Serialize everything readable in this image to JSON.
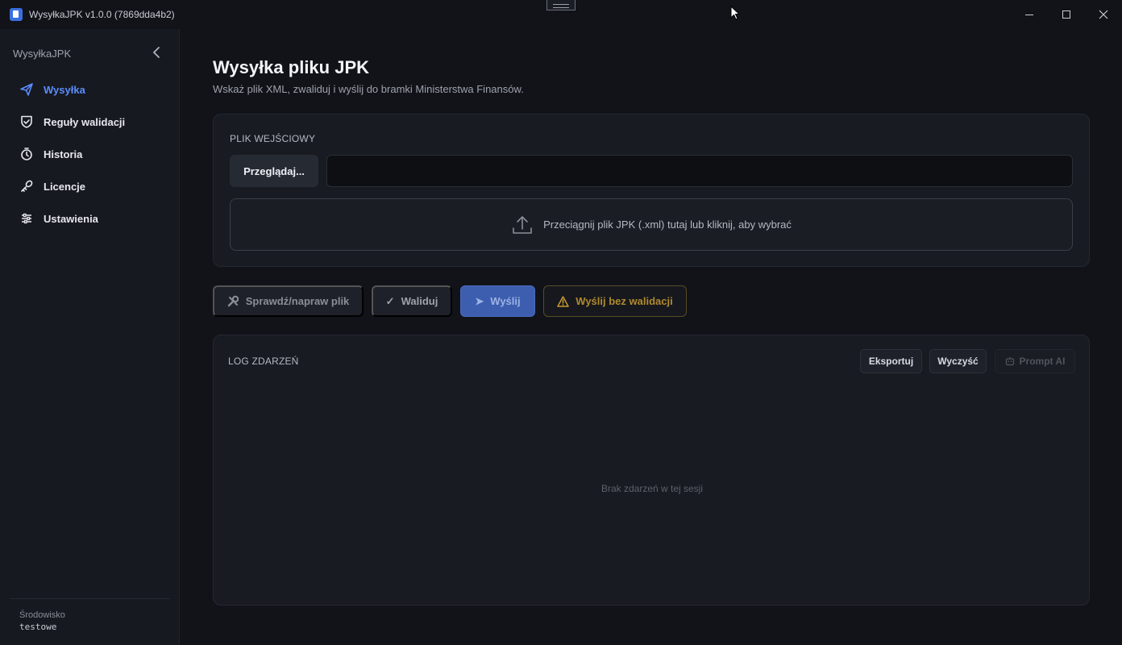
{
  "window": {
    "title": "WysyłkaJPK  v1.0.0 (7869dda4b2)",
    "controls": [
      "minimize",
      "maximize",
      "close"
    ]
  },
  "sidebar": {
    "brand": "WysyłkaJPK",
    "items": [
      {
        "label": "Wysyłka",
        "icon": "send-icon",
        "active": true
      },
      {
        "label": "Reguły walidacji",
        "icon": "shield-check-icon",
        "active": false
      },
      {
        "label": "Historia",
        "icon": "stopwatch-icon",
        "active": false
      },
      {
        "label": "Licencje",
        "icon": "key-icon",
        "active": false
      },
      {
        "label": "Ustawienia",
        "icon": "sliders-icon",
        "active": false
      }
    ],
    "environment_label": "Środowisko",
    "environment_value": "testowe"
  },
  "main": {
    "title": "Wysyłka pliku JPK",
    "subtitle": "Wskaż plik XML, zwaliduj i wyślij do bramki Ministerstwa Finansów."
  },
  "input_file": {
    "section_label": "PLIK WEJŚCIOWY",
    "browse_label": "Przeglądaj...",
    "path_value": "",
    "dropzone_text": "Przeciągnij plik JPK (.xml) tutaj lub kliknij, aby wybrać"
  },
  "actions": {
    "check_label": "Sprawdź/napraw plik",
    "validate_label": "Waliduj",
    "validate_icon": "✓",
    "send_label": "Wyślij",
    "send_icon": "➤",
    "force_send_label": "Wyślij bez walidacji"
  },
  "log": {
    "section_label": "LOG ZDARZEŃ",
    "export_label": "Eksportuj",
    "clear_label": "Wyczyść",
    "prompt_label": "Prompt AI",
    "empty_text": "Brak zdarzeń w tej sesji"
  },
  "colors": {
    "accent": "#5b8cff",
    "background": "#111319",
    "warning": "#b08a2e"
  }
}
